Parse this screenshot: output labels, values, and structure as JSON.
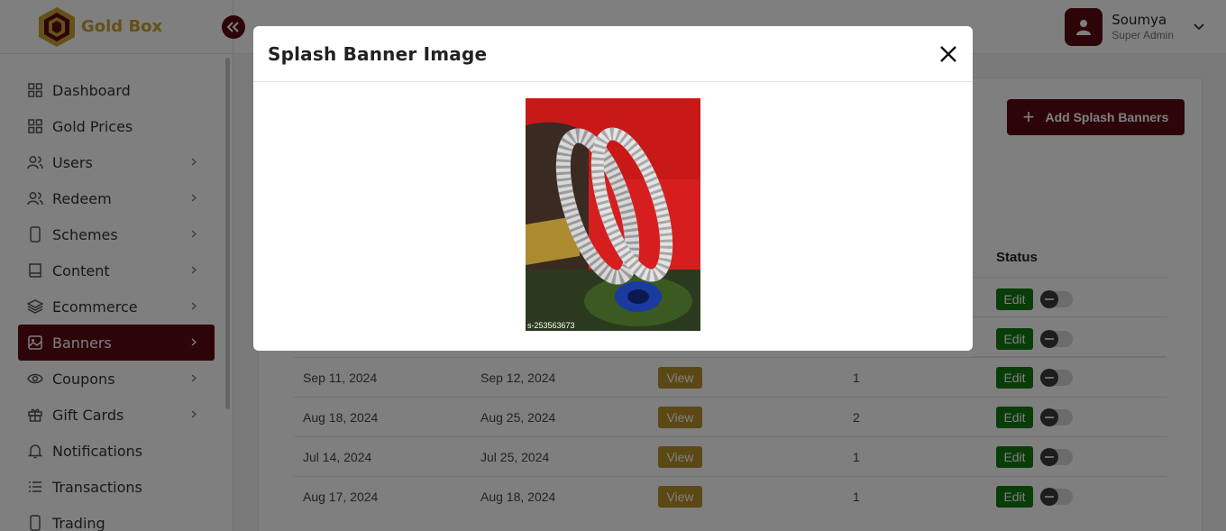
{
  "brand": {
    "name": "Gold Box"
  },
  "header": {
    "user_name": "Soumya",
    "user_role": "Super Admin"
  },
  "sidebar": {
    "items": [
      {
        "label": "Dashboard",
        "icon": "grid-icon",
        "chevron": false
      },
      {
        "label": "Gold Prices",
        "icon": "grid-icon",
        "chevron": false
      },
      {
        "label": "Users",
        "icon": "users-icon",
        "chevron": true
      },
      {
        "label": "Redeem",
        "icon": "users-icon",
        "chevron": true
      },
      {
        "label": "Schemes",
        "icon": "mobile-icon",
        "chevron": true
      },
      {
        "label": "Content",
        "icon": "book-icon",
        "chevron": true
      },
      {
        "label": "Ecommerce",
        "icon": "layers-icon",
        "chevron": true
      },
      {
        "label": "Banners",
        "icon": "image-icon",
        "chevron": true,
        "active": true
      },
      {
        "label": "Coupons",
        "icon": "eye-icon",
        "chevron": true
      },
      {
        "label": "Gift Cards",
        "icon": "gift-icon",
        "chevron": true
      },
      {
        "label": "Notifications",
        "icon": "bell-icon",
        "chevron": false
      },
      {
        "label": "Transactions",
        "icon": "list-icon",
        "chevron": false
      },
      {
        "label": "Trading",
        "icon": "mobile-icon",
        "chevron": false
      }
    ]
  },
  "main": {
    "add_button_label": "Add Splash Banners",
    "status_header": "Status",
    "view_label": "View",
    "edit_label": "Edit",
    "rows": [
      {
        "start": "Sep 11, 2024",
        "end": "Sep 12, 2024",
        "count": "1",
        "active": false
      },
      {
        "start": "Aug 18, 2024",
        "end": "Aug 25, 2024",
        "count": "2",
        "active": false
      },
      {
        "start": "Jul 14, 2024",
        "end": "Jul 25, 2024",
        "count": "1",
        "active": false
      },
      {
        "start": "Aug 17, 2024",
        "end": "Aug 18, 2024",
        "count": "1",
        "active": false
      }
    ]
  },
  "modal": {
    "title": "Splash Banner Image",
    "image_watermark": "s-253563673"
  },
  "colors": {
    "brand": "#5a0a12",
    "gold": "#b8902a",
    "edit": "#117a11"
  }
}
